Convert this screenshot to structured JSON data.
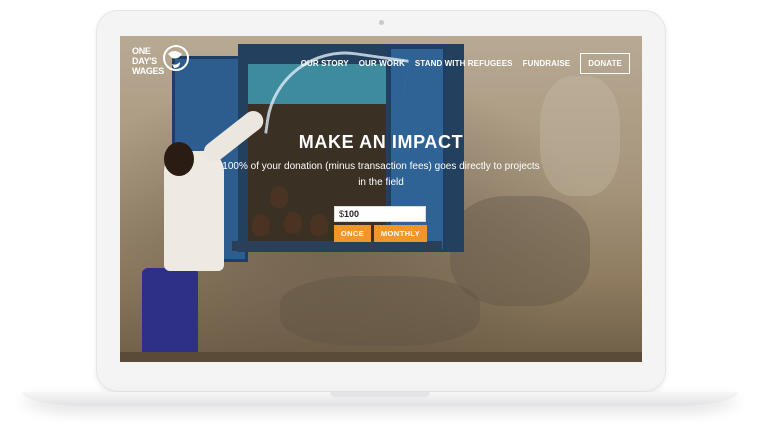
{
  "nav": {
    "logo_text": "ONE DAY'S WAGES",
    "items": [
      {
        "label": "OUR STORY"
      },
      {
        "label": "OUR WORK"
      },
      {
        "label": "STAND WITH REFUGEES"
      },
      {
        "label": "FUNDRAISE"
      }
    ],
    "donate_label": "DONATE"
  },
  "hero": {
    "title": "MAKE AN IMPACT",
    "subtitle": "100% of your donation (minus transaction fees) goes directly to projects in the field"
  },
  "donation": {
    "currency_symbol": "$",
    "amount": "100",
    "once_label": "ONCE",
    "monthly_label": "MONTHLY",
    "accent_color": "#f0962a"
  }
}
